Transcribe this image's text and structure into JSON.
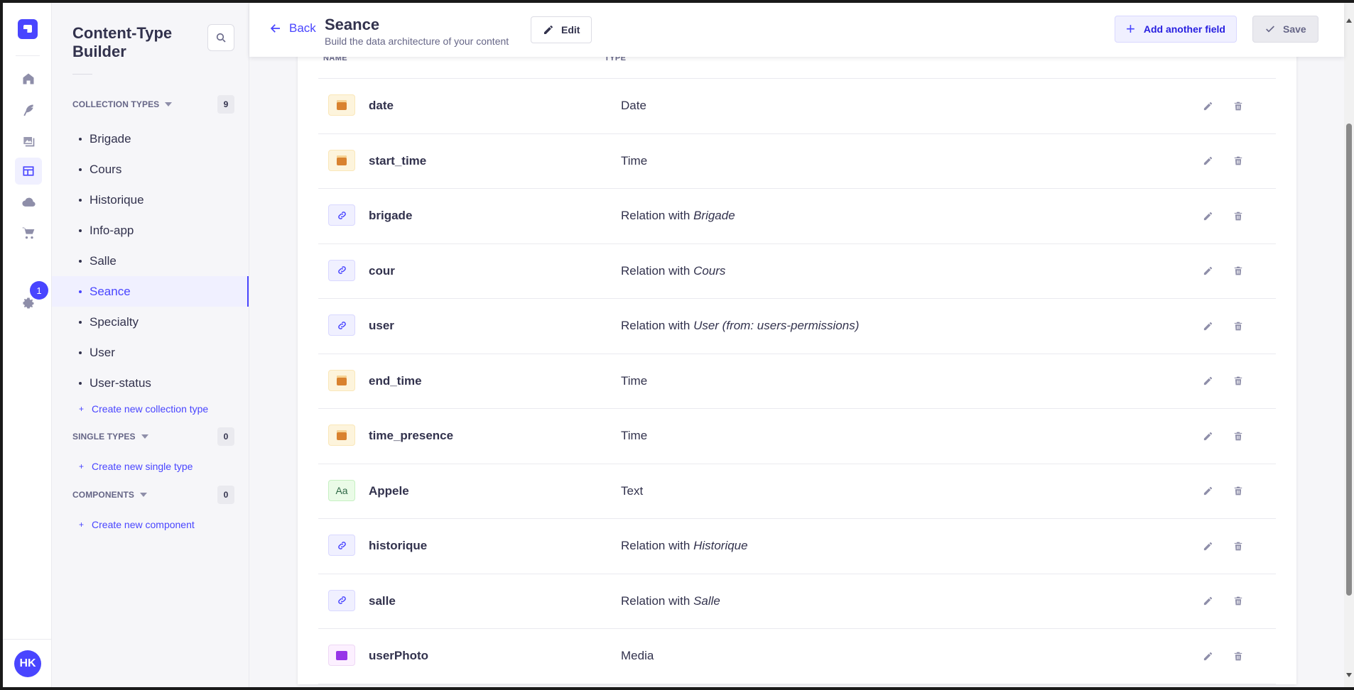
{
  "rail": {
    "notification_count": "1",
    "avatar_initials": "HK"
  },
  "subnav": {
    "title": "Content-Type Builder",
    "collection_types": {
      "label": "COLLECTION TYPES",
      "count": "9",
      "items": [
        {
          "label": "Brigade"
        },
        {
          "label": "Cours"
        },
        {
          "label": "Historique"
        },
        {
          "label": "Info-app"
        },
        {
          "label": "Salle"
        },
        {
          "label": "Seance"
        },
        {
          "label": "Specialty"
        },
        {
          "label": "User"
        },
        {
          "label": "User-status"
        }
      ],
      "create_label": "Create new collection type"
    },
    "single_types": {
      "label": "SINGLE TYPES",
      "count": "0",
      "create_label": "Create new single type"
    },
    "components": {
      "label": "COMPONENTS",
      "count": "0",
      "create_label": "Create new component"
    }
  },
  "header": {
    "back_label": "Back",
    "title": "Seance",
    "subtitle": "Build the data architecture of your content",
    "edit_label": "Edit",
    "add_field_label": "Add another field",
    "save_label": "Save"
  },
  "table": {
    "col_name": "NAME",
    "col_type": "TYPE",
    "rows": [
      {
        "name": "date",
        "type": "Date",
        "target": "",
        "icon": "date"
      },
      {
        "name": "start_time",
        "type": "Time",
        "target": "",
        "icon": "date"
      },
      {
        "name": "brigade",
        "type": "Relation with ",
        "target": "Brigade",
        "icon": "rel"
      },
      {
        "name": "cour",
        "type": "Relation with ",
        "target": "Cours",
        "icon": "rel"
      },
      {
        "name": "user",
        "type": "Relation with ",
        "target": "User (from: users-permissions)",
        "icon": "rel"
      },
      {
        "name": "end_time",
        "type": "Time",
        "target": "",
        "icon": "date"
      },
      {
        "name": "time_presence",
        "type": "Time",
        "target": "",
        "icon": "date"
      },
      {
        "name": "Appele",
        "type": "Text",
        "target": "",
        "icon": "text"
      },
      {
        "name": "historique",
        "type": "Relation with ",
        "target": "Historique",
        "icon": "rel"
      },
      {
        "name": "salle",
        "type": "Relation with ",
        "target": "Salle",
        "icon": "rel"
      },
      {
        "name": "userPhoto",
        "type": "Media",
        "target": "",
        "icon": "media"
      }
    ]
  }
}
